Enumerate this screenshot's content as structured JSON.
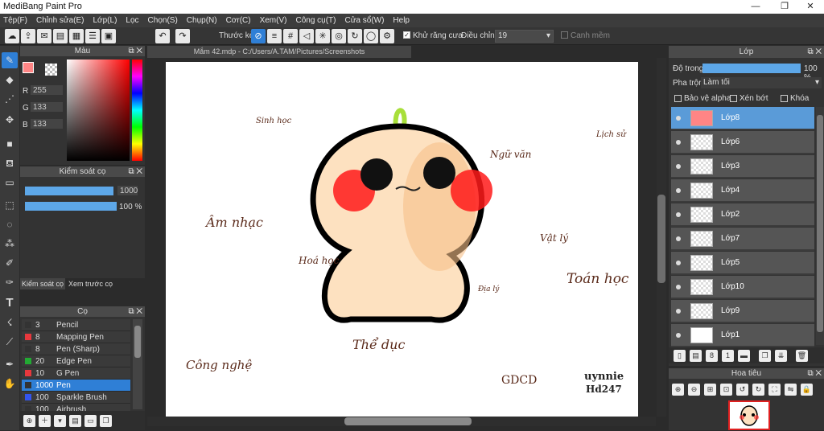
{
  "window": {
    "title": "MediBang Paint Pro",
    "minimize": "—",
    "maximize": "❐",
    "close": "✕"
  },
  "menu": [
    "Tệp(F)",
    "Chỉnh sửa(E)",
    "Lớp(L)",
    "Lọc",
    "Chọn(S)",
    "Chụp(N)",
    "Cơr(C)",
    "Xem(V)",
    "Công cụ(T)",
    "Cửa sổ(W)",
    "Help"
  ],
  "toolbar": {
    "ruler_label": "Thước kẻ",
    "antialias_label": "Khử răng cưa",
    "correction_label": "Điều chỉnh",
    "correction_value": "19",
    "snap_label": "Canh mềm"
  },
  "document": {
    "tab_title": "Mắm 42.mdp - C:/Users/A.TAM/Pictures/Screenshots"
  },
  "color_panel": {
    "title": "Màu",
    "r_label": "R",
    "g_label": "G",
    "b_label": "B",
    "r": "255",
    "g": "133",
    "b": "133",
    "primary_color": "#ff8585"
  },
  "brush_control": {
    "title": "Kiểm soát cọ",
    "size": "1000",
    "opacity": "100 %",
    "size_fraction": 1.0,
    "opacity_fraction": 1.0
  },
  "panel_tabs": {
    "brush_control": "Kiểm soát cọ",
    "brush_preview": "Xem trước cọ"
  },
  "brush_panel": {
    "title": "Cọ",
    "brushes": [
      {
        "size": "3",
        "name": "Pencil",
        "color": "#333333"
      },
      {
        "size": "8",
        "name": "Mapping Pen",
        "color": "#e8383d"
      },
      {
        "size": "8",
        "name": "Pen (Sharp)",
        "color": "#333333"
      },
      {
        "size": "20",
        "name": "Edge Pen",
        "color": "#22aa33"
      },
      {
        "size": "10",
        "name": "G Pen",
        "color": "#e8383d"
      },
      {
        "size": "1000",
        "name": "Pen",
        "color": "#333333"
      },
      {
        "size": "100",
        "name": "Sparkle Brush",
        "color": "#3355ee"
      },
      {
        "size": "100",
        "name": "Airbrush",
        "color": "#333333"
      }
    ]
  },
  "layer_panel": {
    "title": "Lớp",
    "opacity_label": "Độ trong",
    "opacity_value": "100 %",
    "opacity_fraction": 1.0,
    "blend_label": "Pha trộn",
    "blend_value": "Làm tối",
    "protect_alpha": "Bảo vệ alpha",
    "clipping": "Xén bớt",
    "lock": "Khóa",
    "layers": [
      "Lớp8",
      "Lớp6",
      "Lớp3",
      "Lớp4",
      "Lớp2",
      "Lớp7",
      "Lớp5",
      "Lớp10",
      "Lớp9",
      "Lớp1"
    ]
  },
  "navigator": {
    "title": "Hoa tiêu"
  },
  "canvas_text": {
    "sinh": "Sinh học",
    "ngu": "Ngữ văn",
    "lich": "Lịch sử",
    "am": "Âm nhạc",
    "vat": "Vật lý",
    "hoa": "Hoá học",
    "toan": "Toán học",
    "dia": "Địa lý",
    "the": "Thể dục",
    "cong": "Công nghệ",
    "gdcd": "GDCD",
    "sig1": "uynnie",
    "sig2": "Hd247"
  }
}
